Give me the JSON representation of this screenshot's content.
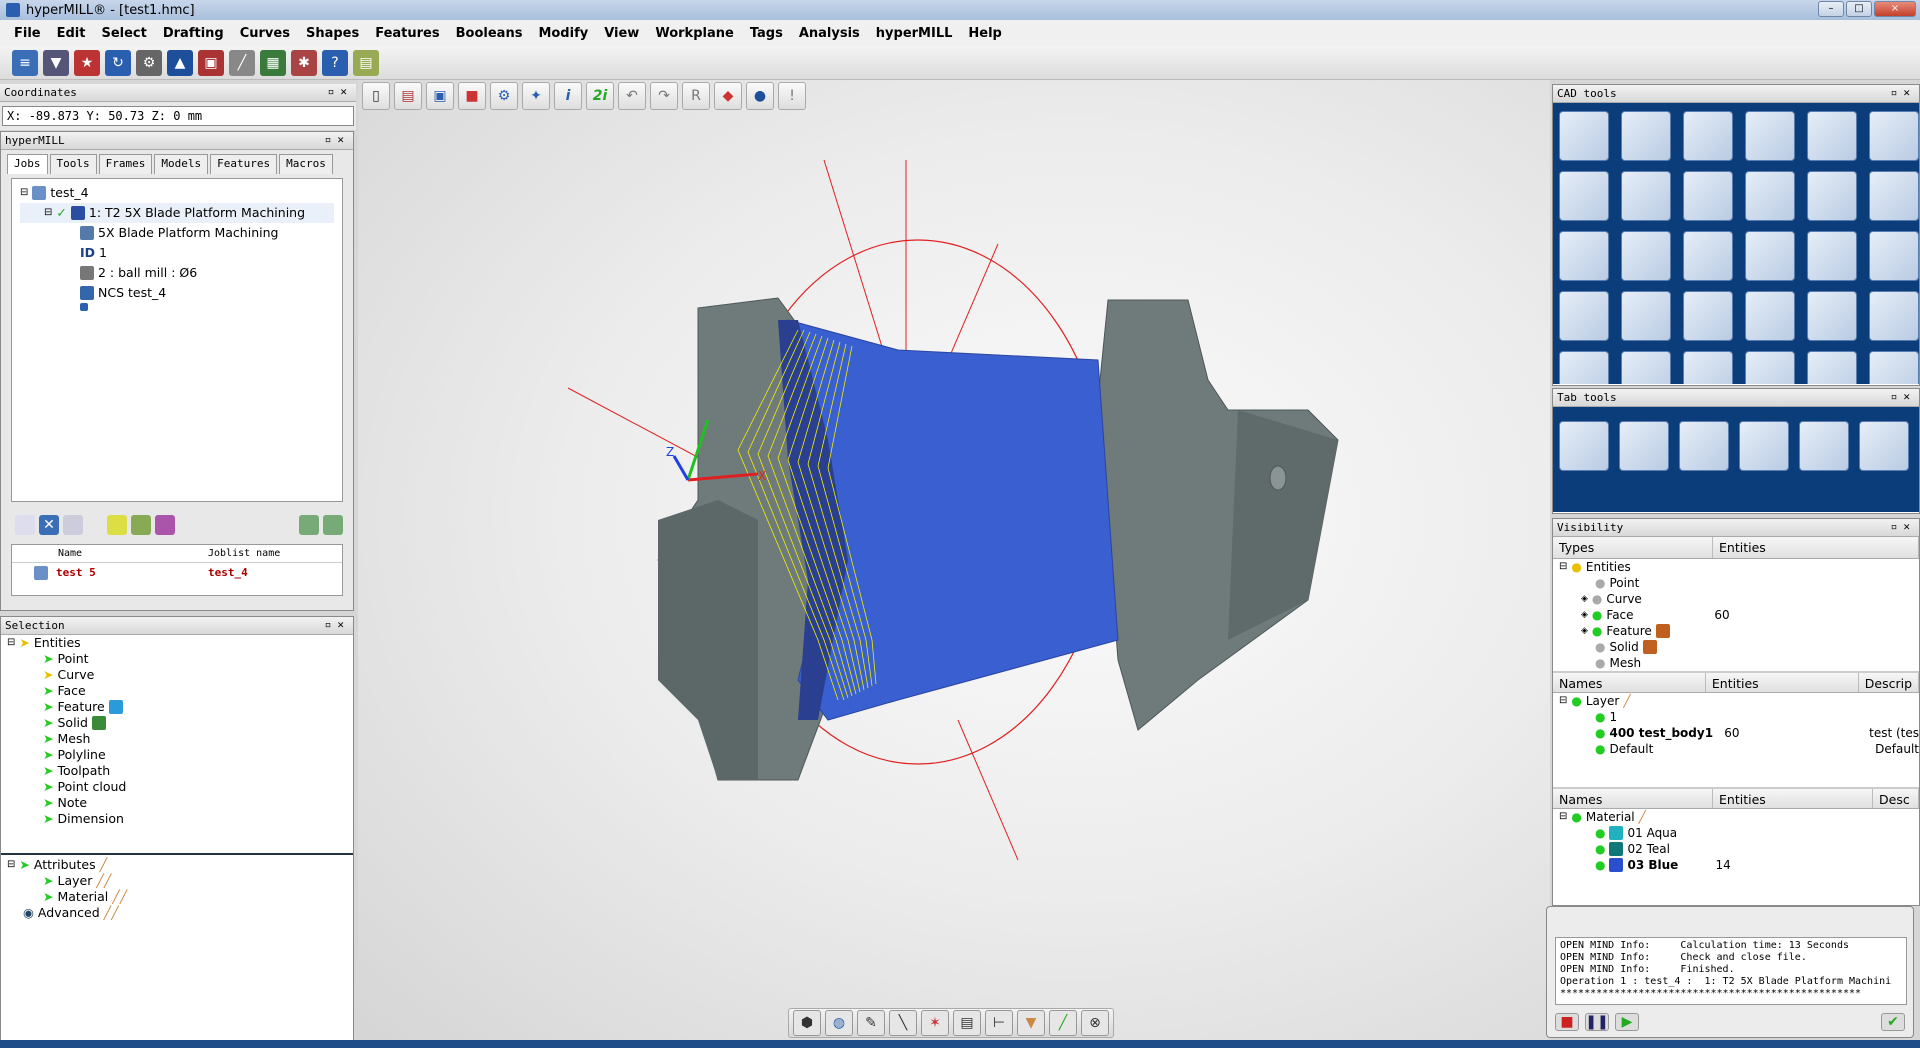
{
  "window": {
    "title": "hyperMILL® - [test1.hmc]"
  },
  "menu": [
    "File",
    "Edit",
    "Select",
    "Drafting",
    "Curves",
    "Shapes",
    "Features",
    "Booleans",
    "Modify",
    "View",
    "Workplane",
    "Tags",
    "Analysis",
    "hyperMILL",
    "Help"
  ],
  "coordinates": {
    "title": "Coordinates",
    "x_label": "X:",
    "x": "-89.873",
    "y_label": "Y:",
    "y": "50.73",
    "z_label": "Z:",
    "z": "0",
    "unit": "mm"
  },
  "hypermill": {
    "title": "hyperMILL",
    "tabs": [
      "Jobs",
      "Tools",
      "Frames",
      "Models",
      "Features",
      "Macros"
    ],
    "tree": [
      "test_4",
      "1: T2 5X Blade Platform Machining",
      "5X Blade Platform Machining",
      "1",
      "2 :  ball mill : Ø6",
      "NCS test_4"
    ],
    "tree_id_label": "ID",
    "joblist_headers": [
      "Name",
      "Joblist name"
    ],
    "joblist_row": {
      "name": "test 5",
      "joblist": "test_4"
    }
  },
  "selection": {
    "title": "Selection",
    "entities": [
      "Entities",
      "Point",
      "Curve",
      "Face",
      "Feature",
      "Solid",
      "Mesh",
      "Polyline",
      "Toolpath",
      "Point cloud",
      "Note",
      "Dimension"
    ],
    "attributes": [
      "Attributes",
      "Layer",
      "Material",
      "Advanced"
    ]
  },
  "cad_tools": {
    "title": "CAD tools"
  },
  "tab_tools": {
    "title": "Tab tools"
  },
  "visibility": {
    "title": "Visibility",
    "types_headers": [
      "Types",
      "Entities"
    ],
    "types": [
      {
        "name": "Entities",
        "count": ""
      },
      {
        "name": "Point",
        "count": ""
      },
      {
        "name": "Curve",
        "count": ""
      },
      {
        "name": "Face",
        "count": "60"
      },
      {
        "name": "Feature",
        "count": ""
      },
      {
        "name": "Solid",
        "count": ""
      },
      {
        "name": "Mesh",
        "count": ""
      }
    ],
    "layer_headers": [
      "Names",
      "Entities",
      "Descrip"
    ],
    "layers": [
      {
        "name": "Layer",
        "count": "",
        "desc": ""
      },
      {
        "name": "1",
        "count": "",
        "desc": ""
      },
      {
        "name": "400 test_body1",
        "count": "60",
        "desc": "test (tes"
      },
      {
        "name": "Default",
        "count": "",
        "desc": "Default"
      }
    ],
    "material_headers": [
      "Names",
      "Entities",
      "Desc"
    ],
    "materials": [
      {
        "name": "Material",
        "count": ""
      },
      {
        "name": "01 Aqua",
        "count": ""
      },
      {
        "name": "02 Teal",
        "count": ""
      },
      {
        "name": "03 Blue",
        "count": "14"
      }
    ]
  },
  "log": [
    "OPEN MIND Info:     Calculation time: 13 Seconds",
    "OPEN MIND Info:     Check and close file.",
    "OPEN MIND Info:     Finished.",
    "Operation 1 : test_4 :  1: T2 5X Blade Platform Machini",
    "**************************************************"
  ],
  "axis_labels": {
    "z": "Z",
    "x": "X"
  },
  "icons": [
    "new-icon",
    "open-icon",
    "save-icon",
    "undo-icon",
    "redo-icon",
    "help-icon"
  ],
  "colors": {
    "accent": "#0a3d7a",
    "part": "#6e7a7a",
    "blade": "#3a5fd0",
    "toolpath": "#f0f000",
    "wireframe": "#e02020"
  }
}
